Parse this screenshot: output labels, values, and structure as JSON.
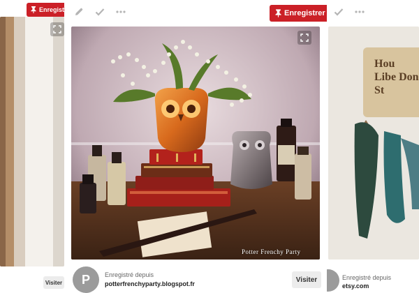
{
  "pins": {
    "left": {
      "save_label": "Enregistrer",
      "visit_label": "Visiter"
    },
    "center": {
      "save_label": "Enregistrer",
      "visit_label": "Visiter",
      "saved_from_label": "Enregistré depuis",
      "source": "potterfrenchyparty.blogspot.fr",
      "avatar_letter": "P",
      "watermark": "Potter Frenchy Party",
      "icons": [
        "pencil-icon",
        "check-icon",
        "more-icon",
        "pin-icon",
        "zoom-icon"
      ]
    },
    "right": {
      "saved_from_label": "Enregistré depuis",
      "source": "etsy.com",
      "sign_text": "Hou Libe Don St",
      "icons": [
        "check-icon",
        "more-icon"
      ]
    }
  },
  "colors": {
    "save_red": "#cb2027",
    "visit_gray": "#ececec",
    "avatar_gray": "#9b9b9b"
  }
}
